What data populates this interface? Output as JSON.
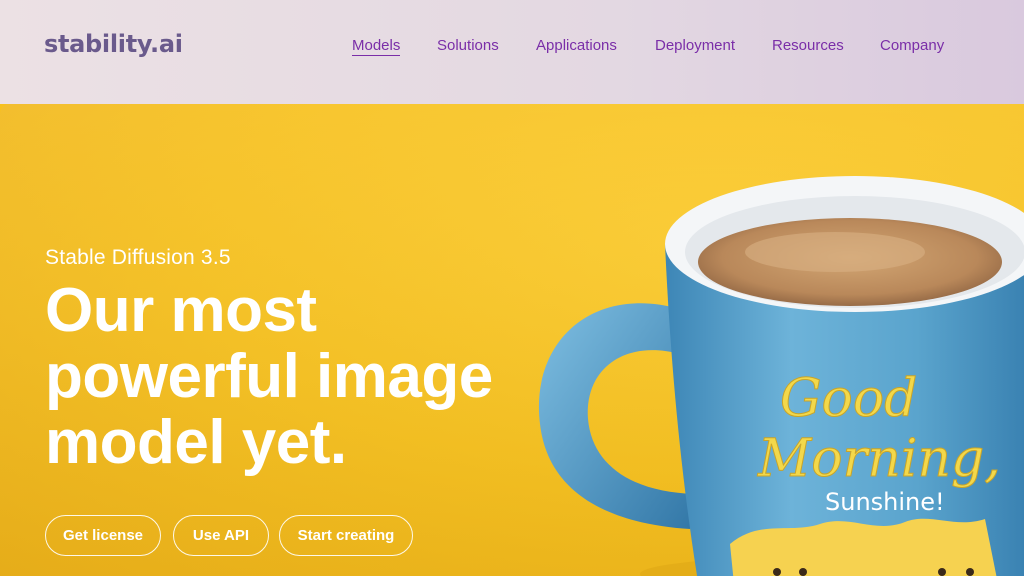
{
  "header": {
    "logo": "stability.ai",
    "nav": [
      {
        "label": "Models",
        "active": true
      },
      {
        "label": "Solutions"
      },
      {
        "label": "Applications"
      },
      {
        "label": "Deployment"
      },
      {
        "label": "Resources"
      },
      {
        "label": "Company"
      }
    ]
  },
  "hero": {
    "eyebrow": "Stable Diffusion 3.5",
    "headline_lines": [
      "Our most",
      "powerful image",
      "model yet."
    ],
    "buttons": [
      "Get license",
      "Use API",
      "Start creating"
    ],
    "image": {
      "mug_text_line1": "Good",
      "mug_text_line2": "Morning,",
      "mug_text_line3": "Sunshine!"
    }
  },
  "colors": {
    "background": "#f7c11e",
    "nav_text": "#7a2ea8",
    "logo": "#6a5a8c",
    "mug": "#5ea6cf"
  }
}
